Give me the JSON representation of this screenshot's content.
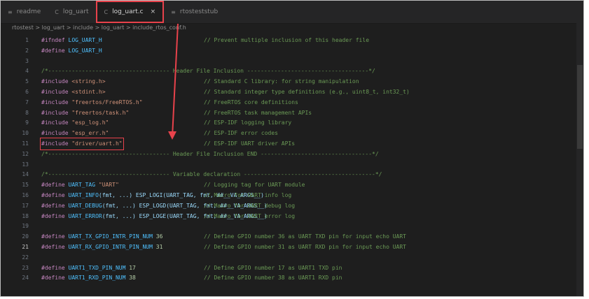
{
  "tabs": [
    {
      "label": "readme",
      "icon": "file-icon"
    },
    {
      "label": "log_uart",
      "icon": "c-file-icon"
    },
    {
      "label": "log_uart.c",
      "icon": "c-file-icon",
      "active": true,
      "close": "×"
    },
    {
      "label": "rtosteststub",
      "icon": "file-icon"
    }
  ],
  "breadcrumb": "rtostest > log_uart > include > log_uart > include_rtos_conf.h",
  "lines": [
    {
      "n": "1",
      "parts": [
        [
          "kw",
          "#ifndef "
        ],
        [
          "mac",
          "LOG_UART_H"
        ]
      ],
      "c": "// Prevent multiple inclusion of this header file"
    },
    {
      "n": "2",
      "parts": [
        [
          "kw",
          "#define "
        ],
        [
          "mac",
          "LOG_UART_H"
        ]
      ],
      "c": ""
    },
    {
      "n": "3",
      "parts": [],
      "c": ""
    },
    {
      "n": "4",
      "parts": [
        [
          "sep",
          "/*------------------------------------ Header File Inclusion ------------------------------------*/"
        ]
      ],
      "c": ""
    },
    {
      "n": "5",
      "parts": [
        [
          "kw",
          "#include "
        ],
        [
          "str",
          "<string.h>"
        ]
      ],
      "c": "// Standard C library: for string manipulation"
    },
    {
      "n": "6",
      "parts": [
        [
          "kw",
          "#include "
        ],
        [
          "str",
          "<stdint.h>"
        ]
      ],
      "c": "// Standard integer type definitions (e.g., uint8_t, int32_t)"
    },
    {
      "n": "7",
      "parts": [
        [
          "kw",
          "#include "
        ],
        [
          "str",
          "\"freertos/FreeRTOS.h\""
        ]
      ],
      "c": "// FreeRTOS core definitions"
    },
    {
      "n": "8",
      "parts": [
        [
          "kw",
          "#include "
        ],
        [
          "str",
          "\"freertos/task.h\""
        ]
      ],
      "c": "// FreeRTOS task management APIs"
    },
    {
      "n": "9",
      "parts": [
        [
          "kw",
          "#include "
        ],
        [
          "str",
          "\"esp_log.h\""
        ]
      ],
      "c": "// ESP-IDF logging library"
    },
    {
      "n": "10",
      "parts": [
        [
          "kw",
          "#include "
        ],
        [
          "str",
          "\"esp_err.h\""
        ]
      ],
      "c": "// ESP-IDF error codes"
    },
    {
      "n": "11",
      "parts": [
        [
          "kw",
          "#include "
        ],
        [
          "str",
          "\"driver/uart.h\""
        ]
      ],
      "c": "// ESP-IDF UART driver APIs",
      "hl": true
    },
    {
      "n": "12",
      "parts": [
        [
          "sep",
          "/*------------------------------------ Header File Inclusion END ---------------------------------*/"
        ]
      ],
      "c": ""
    },
    {
      "n": "13",
      "parts": [],
      "c": ""
    },
    {
      "n": "14",
      "parts": [
        [
          "sep",
          "/*------------------------------------ Variable declaration ---------------------------------------*/"
        ]
      ],
      "c": ""
    },
    {
      "n": "15",
      "parts": [
        [
          "kw",
          "#define "
        ],
        [
          "mac",
          "UART_TAG "
        ],
        [
          "str",
          "\"UART\""
        ]
      ],
      "c": "// Logging tag for UART module"
    },
    {
      "n": "16",
      "parts": [
        [
          "kw",
          "#define "
        ],
        [
          "mac",
          "UART_INFO"
        ],
        [
          "plain",
          "(fmt, ...) ESP_LOGI(UART_TAG, fmt, ##__VA_ARGS__)"
        ]
      ],
      "c": "// Macro for UART info log"
    },
    {
      "n": "17",
      "parts": [
        [
          "kw",
          "#define "
        ],
        [
          "mac",
          "UART_DEBUG"
        ],
        [
          "plain",
          "(fmt, ...) ESP_LOGD(UART_TAG, fmt, ##__VA_ARGS__)"
        ]
      ],
      "c": "// Macro for UART debug log"
    },
    {
      "n": "18",
      "parts": [
        [
          "kw",
          "#define "
        ],
        [
          "mac",
          "UART_ERROR"
        ],
        [
          "plain",
          "(fmt, ...) ESP_LOGE(UART_TAG, fmt, ##__VA_ARGS__)"
        ]
      ],
      "c": "// Macro for UART error log"
    },
    {
      "n": "19",
      "parts": [],
      "c": ""
    },
    {
      "n": "20",
      "parts": [
        [
          "kw",
          "#define "
        ],
        [
          "mac",
          "UART_TX_GPIO_INTR_PIN_NUM "
        ],
        [
          "num",
          "36"
        ]
      ],
      "c": "// Define GPIO number 36 as UART TXD pin for input echo UART"
    },
    {
      "n": "21",
      "parts": [
        [
          "kw",
          "#define "
        ],
        [
          "mac",
          "UART_RX_GPIO_INTR_PIN_NUM "
        ],
        [
          "num",
          "31"
        ]
      ],
      "c": "// Define GPIO number 31 as UART RXD pin for input echo UART",
      "cur": true
    },
    {
      "n": "22",
      "parts": [],
      "c": ""
    },
    {
      "n": "23",
      "parts": [
        [
          "kw",
          "#define "
        ],
        [
          "mac",
          "UART1_TXD_PIN_NUM "
        ],
        [
          "num",
          "17"
        ]
      ],
      "c": "// Define GPIO number 17 as UART1 TXD pin"
    },
    {
      "n": "24",
      "parts": [
        [
          "kw",
          "#define "
        ],
        [
          "mac",
          "UART1_RXD_PIN_NUM "
        ],
        [
          "num",
          "38"
        ]
      ],
      "c": "// Define GPIO number 38 as UART1 RXD pin"
    }
  ],
  "colors": {
    "accent": "#e8424b",
    "background": "#1e1e1e",
    "comment": "#6a9955",
    "keyword": "#c586c0",
    "string": "#ce9178"
  }
}
